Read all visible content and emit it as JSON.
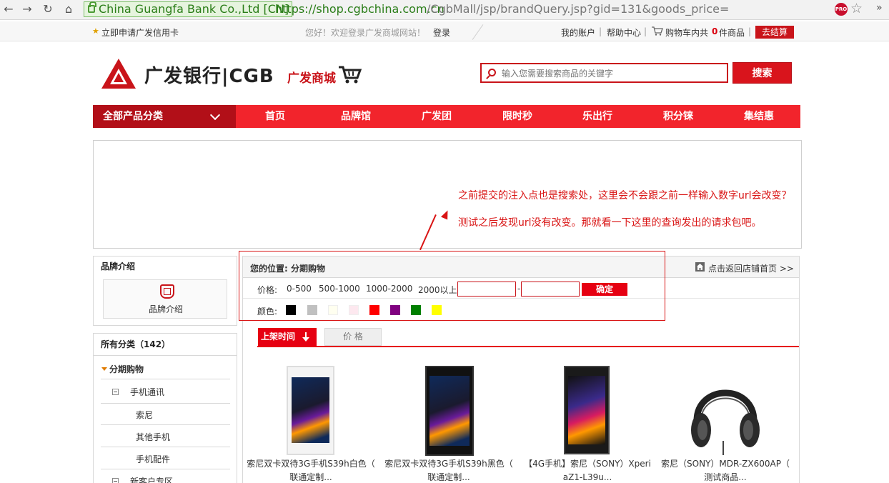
{
  "browser": {
    "secure_label": "China Guangfa Bank Co.,Ltd [CN]",
    "url_host": "https://shop.cgbchina.com.cn",
    "url_path": "/CgbMall/jsp/brandQuery.jsp?gid=131&goods_price=",
    "ext_label": "PRO",
    "nav_icons": [
      "back-arrow-icon",
      "forward-arrow-icon",
      "reload-icon",
      "home-icon"
    ],
    "more_symbol": "»"
  },
  "topbar": {
    "apply_card": "立即申请广发信用卡",
    "welcome": "您好！欢迎登录广发商城网站！",
    "login": "登录",
    "my_account": "我的账户",
    "sep": "|",
    "help": "帮助中心",
    "cart_prefix": "购物车内共",
    "cart_count": "0",
    "cart_suffix": "件商品",
    "checkout": "去结算"
  },
  "header": {
    "logo_text": "广发银行|CGB",
    "logo_sub": "广发商城",
    "search_placeholder": "输入您需要搜索商品的关键字",
    "search_button": "搜索"
  },
  "nav": {
    "all_categories": "全部产品分类",
    "items": [
      "首页",
      "品牌馆",
      "广发团",
      "限时秒",
      "乐出行",
      "积分铼",
      "集结惠"
    ]
  },
  "annotation": {
    "line1": "之前提交的注入点也是搜索处，这里会不会跟之前一样输入数字url会改变？",
    "line2": "测试之后发现url没有改变。那就看一下这里的查询发出的请求包吧。"
  },
  "sidebar": {
    "brand_title": "品牌介绍",
    "brand_card_label": "品牌介绍",
    "all_categories_label": "所有分类（",
    "all_categories_count": "142",
    "all_categories_close": "）",
    "section": "分期购物",
    "group1": "手机通讯",
    "items": [
      "索尼",
      "其他手机",
      "手机配件"
    ],
    "group2": "新客户专区"
  },
  "filter": {
    "breadcrumb": "您的位置: 分期购物",
    "back_to_store": "点击返回店铺首页 >>",
    "price_label": "价格:",
    "price_ranges": [
      "0-500",
      "500-1000",
      "1000-2000",
      "2000以上"
    ],
    "range_dash": "-",
    "confirm": "确定",
    "color_label": "颜色:",
    "colors": [
      "#000000",
      "#c0c0c0",
      "#fffff0",
      "#fde8ef",
      "#ff0000",
      "#800080",
      "#008000",
      "#ffff00"
    ]
  },
  "tabs": {
    "time": "上架时间",
    "price": "价 格"
  },
  "products": [
    {
      "line1": "索尼双卡双待3G手机S39h白色（",
      "line2": "联通定制..."
    },
    {
      "line1": "索尼双卡双待3G手机S39h黑色（",
      "line2": "联通定制..."
    },
    {
      "line1": "【4G手机】索尼（SONY）Xperi",
      "line2": "aZ1-L39u..."
    },
    {
      "line1": "索尼（SONY）MDR-ZX600AP（",
      "line2": "测试商品..."
    }
  ]
}
